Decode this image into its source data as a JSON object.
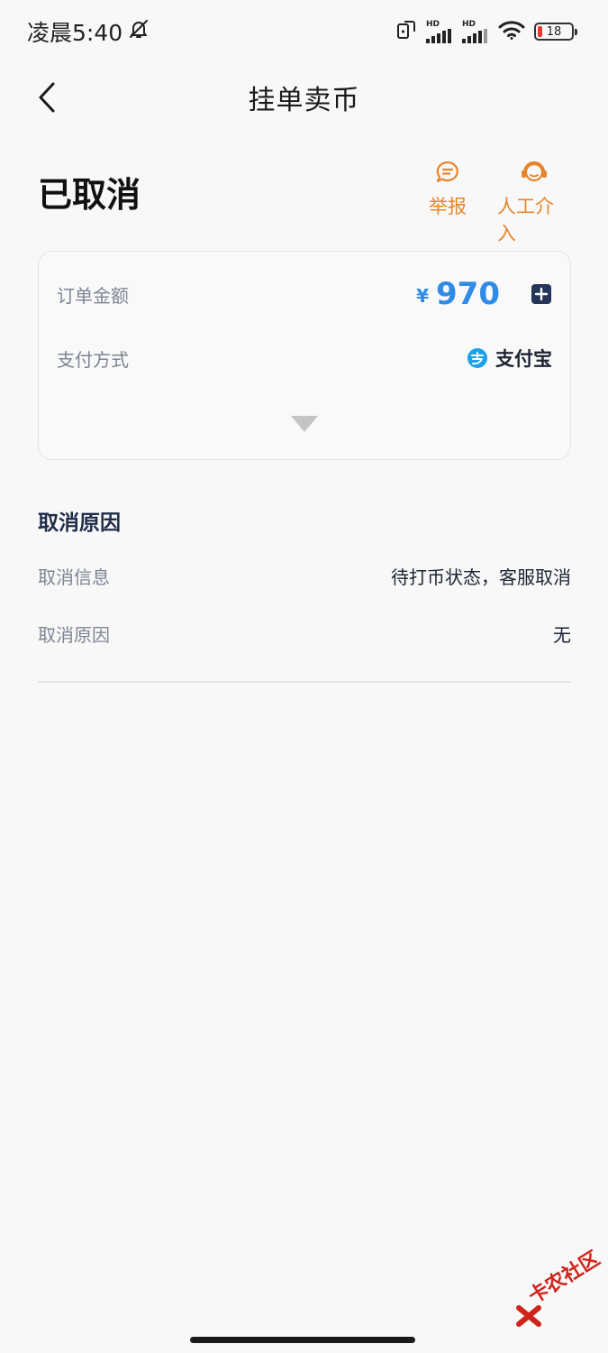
{
  "status_bar": {
    "time": "凌晨5:40",
    "hd1": "HD",
    "hd2": "HD",
    "battery": "18",
    "battery_color": "#e53935"
  },
  "nav": {
    "title": "挂单卖币",
    "back_icon": "chevron-left-icon"
  },
  "order": {
    "status": "已取消",
    "actions": {
      "report_label": "举报",
      "support_label": "人工介入"
    }
  },
  "card": {
    "amount_label": "订单金额",
    "currency": "¥",
    "amount": "970",
    "payment_label": "支付方式",
    "payment_method": "支付宝"
  },
  "cancel": {
    "section_title": "取消原因",
    "info_label": "取消信息",
    "info_value": "待打币状态，客服取消",
    "reason_label": "取消原因",
    "reason_value": "无"
  },
  "watermark": {
    "text": "卡农社区"
  },
  "colors": {
    "accent_orange": "#e8852a",
    "amount_blue": "#2f8be6",
    "alipay_blue": "#1aa3e8"
  }
}
